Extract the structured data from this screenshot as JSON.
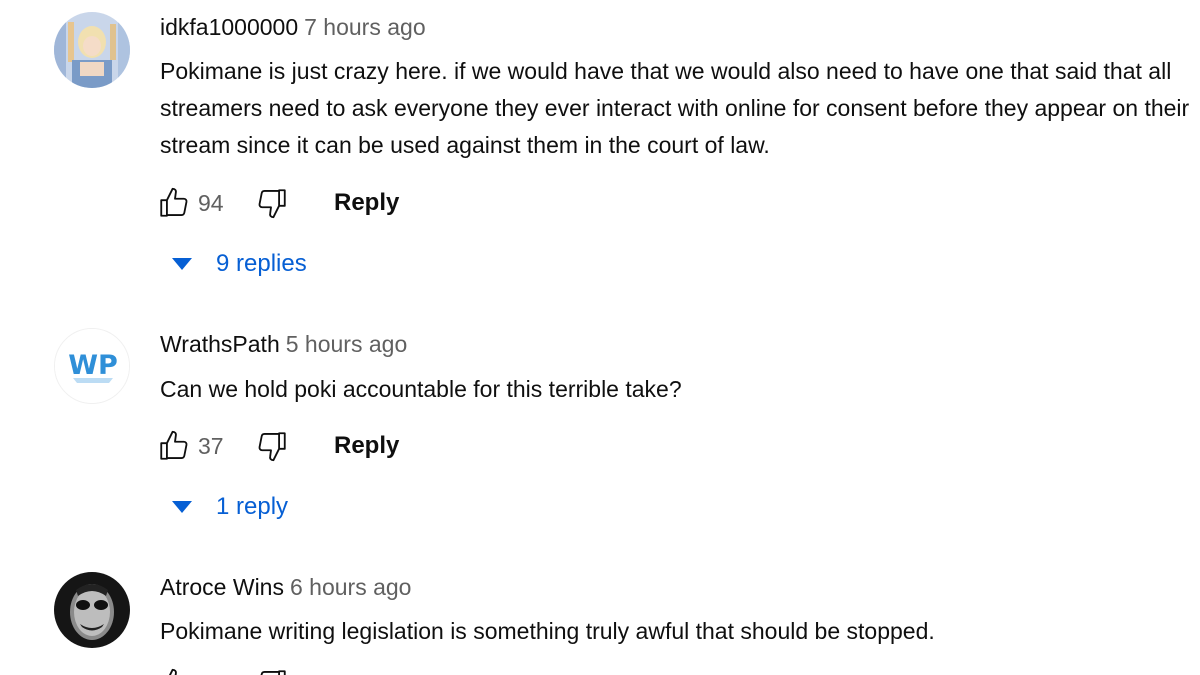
{
  "comments": [
    {
      "author": "idkfa1000000",
      "time": "7 hours ago",
      "text": "Pokimane is just crazy here. if we would have that we would also need to have one that said that all streamers need to ask everyone they ever interact with online for consent before they appear on their stream since it can be used against them in the court of law.",
      "likes": "94",
      "reply_label": "Reply",
      "replies_label": "9 replies",
      "avatar_icon": "pastel-character-avatar-icon"
    },
    {
      "author": "WrathsPath",
      "time": "5 hours ago",
      "text": "Can we hold poki accountable for this terrible take?",
      "likes": "37",
      "reply_label": "Reply",
      "replies_label": "1 reply",
      "avatar_logo_text": "WP",
      "avatar_icon": "wp-logo-avatar-icon"
    },
    {
      "author": "Atroce Wins",
      "time": "6 hours ago",
      "text": "Pokimane writing legislation is something truly awful that should be stopped.",
      "avatar_icon": "dark-face-avatar-icon"
    }
  ],
  "colors": {
    "link_blue": "#065fd4",
    "secondary_text": "#606060",
    "primary_text": "#0f0f0f"
  },
  "icons": [
    "thumbs-up-icon",
    "thumbs-down-icon",
    "caret-down-icon"
  ]
}
